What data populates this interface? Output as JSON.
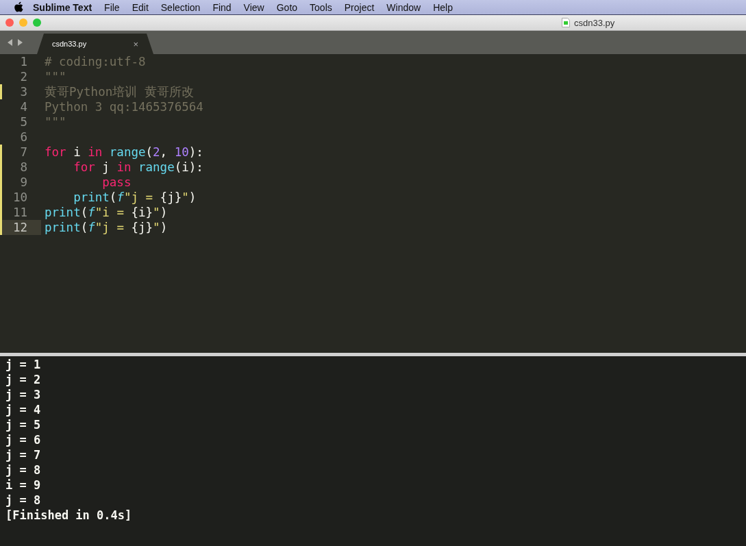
{
  "menubar": {
    "app_name": "Sublime Text",
    "items": [
      "File",
      "Edit",
      "Selection",
      "Find",
      "View",
      "Goto",
      "Tools",
      "Project",
      "Window",
      "Help"
    ]
  },
  "window": {
    "title": "csdn33.py"
  },
  "tabs": [
    {
      "label": "csdn33.py",
      "selected": true,
      "close": "×"
    }
  ],
  "editor": {
    "lines": [
      {
        "number": "1",
        "modified": false,
        "current": false,
        "tokens": [
          {
            "kind": "comment",
            "text": "# coding:utf-8"
          }
        ]
      },
      {
        "number": "2",
        "modified": false,
        "current": false,
        "tokens": [
          {
            "kind": "comment",
            "text": "\"\"\""
          }
        ]
      },
      {
        "number": "3",
        "modified": true,
        "current": false,
        "tokens": [
          {
            "kind": "comment",
            "text": "黄哥Python培训 黄哥所改"
          }
        ]
      },
      {
        "number": "4",
        "modified": false,
        "current": false,
        "tokens": [
          {
            "kind": "comment",
            "text": "Python 3 qq:1465376564"
          }
        ]
      },
      {
        "number": "5",
        "modified": false,
        "current": false,
        "tokens": [
          {
            "kind": "comment",
            "text": "\"\"\""
          }
        ]
      },
      {
        "number": "6",
        "modified": false,
        "current": false
      },
      {
        "number": "7",
        "modified": true,
        "current": false,
        "tokens": [
          {
            "kind": "keyword",
            "text": "for"
          },
          {
            "kind": "plain",
            "text": " i "
          },
          {
            "kind": "keyword",
            "text": "in "
          },
          {
            "kind": "function",
            "text": "range"
          },
          {
            "kind": "plain",
            "text": "("
          },
          {
            "kind": "number",
            "text": "2"
          },
          {
            "kind": "plain",
            "text": ", "
          },
          {
            "kind": "number",
            "text": "10"
          },
          {
            "kind": "plain",
            "text": "):"
          }
        ]
      },
      {
        "number": "8",
        "modified": true,
        "current": false,
        "tokens": [
          {
            "kind": "keyword",
            "text": "    for"
          },
          {
            "kind": "plain",
            "text": " j "
          },
          {
            "kind": "keyword",
            "text": "in "
          },
          {
            "kind": "function",
            "text": "range"
          },
          {
            "kind": "plain",
            "text": "(i):"
          }
        ]
      },
      {
        "number": "9",
        "modified": true,
        "current": false,
        "tokens": [
          {
            "kind": "keyword",
            "text": "        pass"
          }
        ]
      },
      {
        "number": "10",
        "modified": true,
        "current": false,
        "tokens": [
          {
            "kind": "function",
            "text": "    print"
          },
          {
            "kind": "plain",
            "text": "("
          },
          {
            "kind": "prefix",
            "text": "f"
          },
          {
            "kind": "string",
            "text": "\"j = "
          },
          {
            "kind": "plain",
            "text": "{j}"
          },
          {
            "kind": "string",
            "text": "\""
          },
          {
            "kind": "plain",
            "text": ")"
          }
        ]
      },
      {
        "number": "11",
        "modified": true,
        "current": false,
        "tokens": [
          {
            "kind": "function",
            "text": "print"
          },
          {
            "kind": "plain",
            "text": "("
          },
          {
            "kind": "prefix",
            "text": "f"
          },
          {
            "kind": "string",
            "text": "\"i = "
          },
          {
            "kind": "plain",
            "text": "{i}"
          },
          {
            "kind": "string",
            "text": "\""
          },
          {
            "kind": "plain",
            "text": ")"
          }
        ]
      },
      {
        "number": "12",
        "modified": true,
        "current": true,
        "tokens": [
          {
            "kind": "function",
            "text": "print"
          },
          {
            "kind": "plain",
            "text": "("
          },
          {
            "kind": "prefix",
            "text": "f"
          },
          {
            "kind": "string",
            "text": "\"j = "
          },
          {
            "kind": "plain",
            "text": "{j}"
          },
          {
            "kind": "string",
            "text": "\""
          },
          {
            "kind": "plain",
            "text": ")"
          }
        ]
      }
    ]
  },
  "output": {
    "lines": [
      "j = 1",
      "j = 2",
      "j = 3",
      "j = 4",
      "j = 5",
      "j = 6",
      "j = 7",
      "j = 8",
      "i = 9",
      "j = 8",
      "[Finished in 0.4s]"
    ]
  }
}
